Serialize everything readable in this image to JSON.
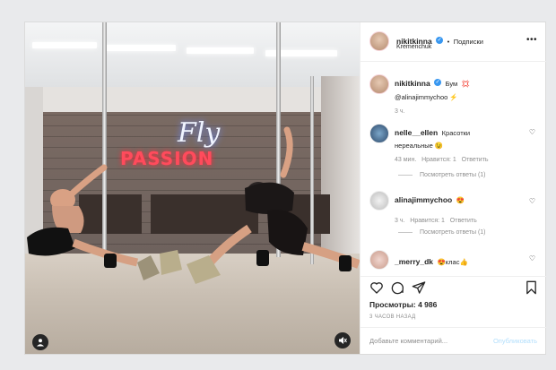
{
  "post": {
    "author": "nikitkinna",
    "follow_separator": "•",
    "follow_label": "Подписки",
    "location": "Kremenchuk",
    "more_icon": "more-horizontal-icon",
    "caption_text": "Бум",
    "caption_emoji": "💢",
    "caption_mention": "@alinajimmychoo",
    "caption_emoji2": "⚡",
    "caption_time": "3 ч.",
    "views_label": "Просмотры: 4 986",
    "posted_ago": "3 ЧАСОВ НАЗАД",
    "comment_placeholder": "Добавьте комментарий...",
    "publish_label": "Опубликовать"
  },
  "media": {
    "sign_passion": "PASSION",
    "sign_fly": "Fly"
  },
  "comments": [
    {
      "user": "nelle__ellen",
      "text_line1": "Красотки",
      "text_line2": "нереальные 😉",
      "time": "43 мин.",
      "likes": "Нравится: 1",
      "reply": "Ответить",
      "view_replies": "Посмотреть ответы (1)"
    },
    {
      "user": "alinajimmychoo",
      "text_line1": "😍",
      "time": "3 ч.",
      "likes": "Нравится: 1",
      "reply": "Ответить",
      "view_replies": "Посмотреть ответы (1)"
    },
    {
      "user": "_merry_dk",
      "text_line1": "😍клас👍"
    }
  ],
  "colors": {
    "accent": "#3897f0",
    "sign_red": "#ff4b5c",
    "publish_disabled": "#b2dffc"
  }
}
